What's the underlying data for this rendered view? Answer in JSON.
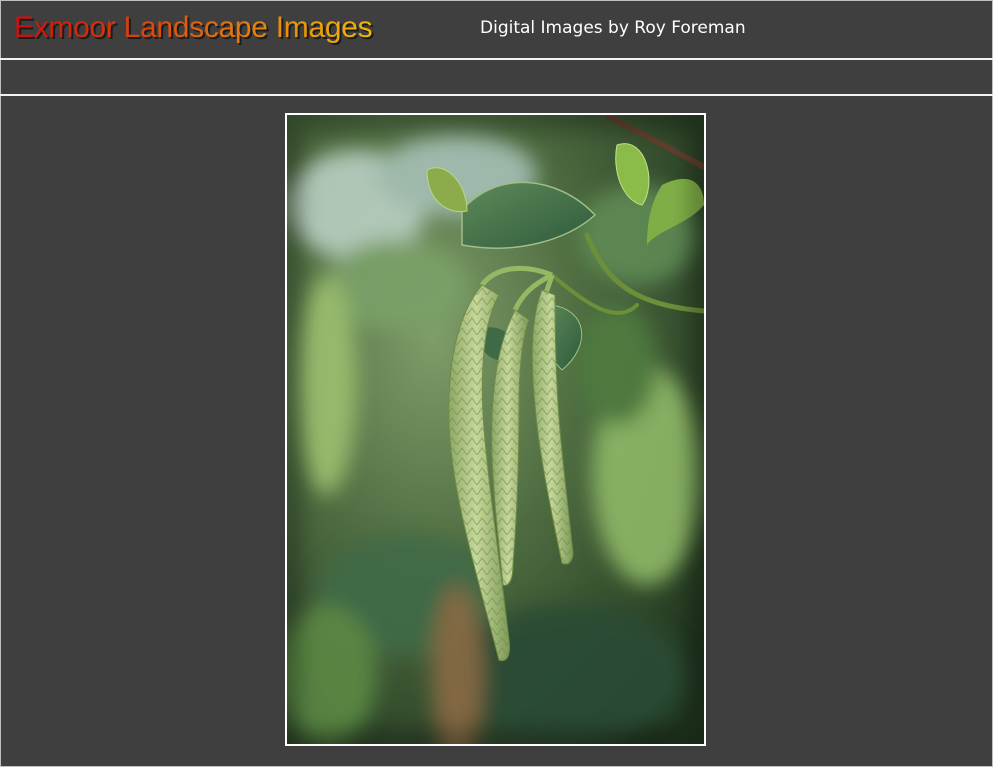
{
  "header": {
    "title": "Exmoor Landscape Images",
    "subtitle": "Digital Images by Roy Foreman"
  },
  "photo": {
    "subject": "catkins-photo"
  },
  "colors": {
    "background": "#3f3f3f",
    "rule": "#f2f2f2",
    "title_gradient_start": "#c90f0f",
    "title_gradient_end": "#f0b808",
    "subtitle": "#ffffff"
  }
}
